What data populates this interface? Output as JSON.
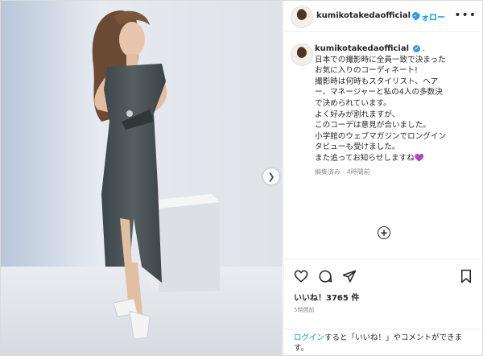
{
  "post": {
    "username": "kumikotakedaofficial",
    "follow_label": "フォロー",
    "more_label": "•••",
    "verified_mark": "✔",
    "caption_lines": [
      ".",
      "日本での撮影時に全員一致で決まった",
      "お気に入りのコーディネート!",
      "撮影時は何時もスタイリスト、ヘア",
      "ー、マネージャーと私の4人の多数決",
      "で決められています。",
      "よく好みが割れますが、",
      "このコーデは意見が合いました。",
      "小学館のウェブマガジンでロングイン",
      "タビューも受けました。",
      "また追ってお知らせしますね"
    ],
    "heart_emoji": "💜",
    "edit_meta": "編集済み · 4時間前",
    "likes_text": "いいね！3765 件",
    "time_ago": "5時間前",
    "login_prefix": "ログイン",
    "login_suffix": "すると「いいね！」やコメントができます。"
  },
  "icons": {
    "next": "chevron-right-icon",
    "like": "heart-icon",
    "comment": "comment-icon",
    "share": "share-icon",
    "save": "bookmark-icon",
    "more": "more-icon",
    "load_comments": "plus-circle-icon"
  },
  "colors": {
    "accent": "#0095f6",
    "verified": "#3897f0",
    "text": "#262626",
    "muted": "#8e8e8e"
  }
}
